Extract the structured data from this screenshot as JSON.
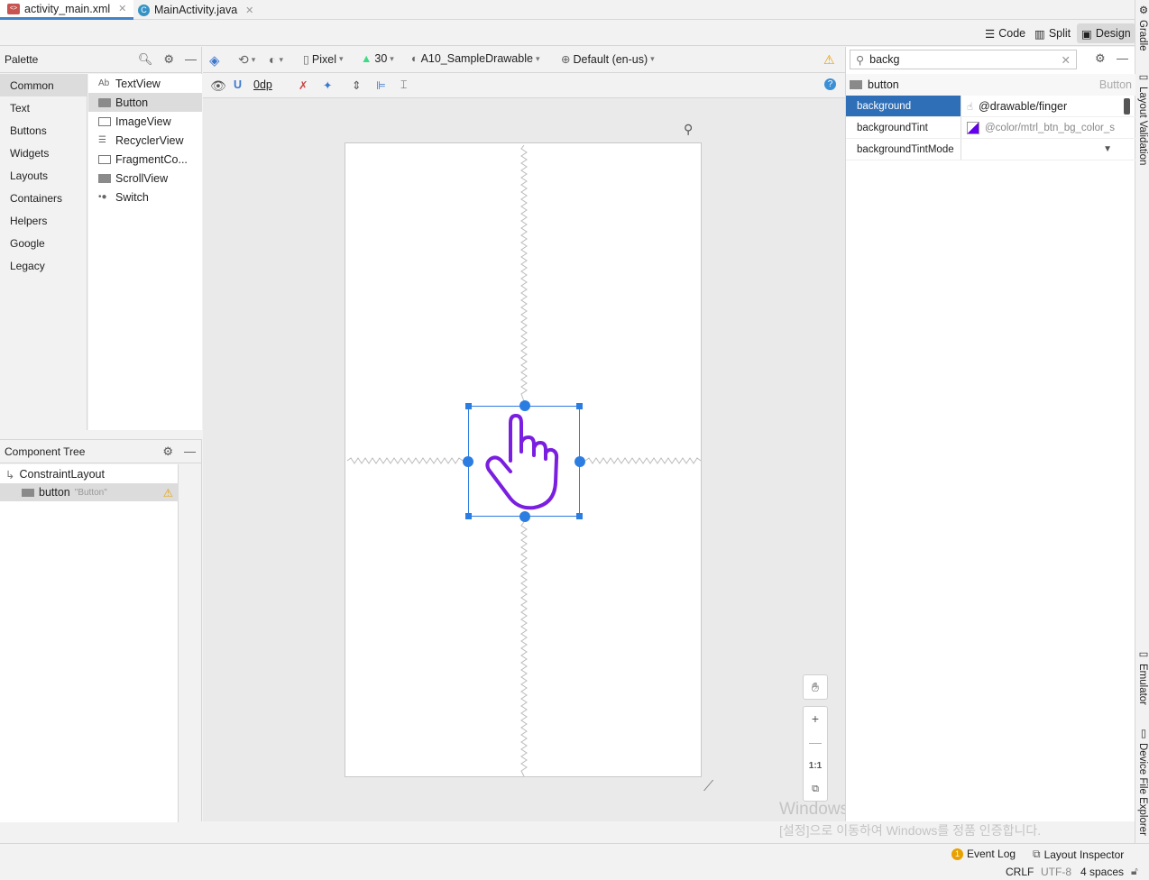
{
  "tabs": [
    {
      "label": "activity_main.xml",
      "icon": "xml-file-icon"
    },
    {
      "label": "MainActivity.java",
      "icon": "java-class-icon",
      "icon_letter": "C"
    }
  ],
  "view_modes": {
    "code": "Code",
    "split": "Split",
    "design": "Design"
  },
  "right_tools": {
    "gradle": "Gradle",
    "layout_validation": "Layout Validation",
    "emulator": "Emulator",
    "device_file_explorer": "Device File Explorer"
  },
  "palette": {
    "title": "Palette",
    "categories": [
      "Common",
      "Text",
      "Buttons",
      "Widgets",
      "Layouts",
      "Containers",
      "Helpers",
      "Google",
      "Legacy"
    ],
    "items": [
      {
        "label": "TextView",
        "icon": "Ab"
      },
      {
        "label": "Button",
        "icon": ""
      },
      {
        "label": "ImageView",
        "icon": ""
      },
      {
        "label": "RecyclerView",
        "icon": ""
      },
      {
        "label": "FragmentCo...",
        "icon": ""
      },
      {
        "label": "ScrollView",
        "icon": ""
      },
      {
        "label": "Switch",
        "icon": ""
      }
    ]
  },
  "component_tree": {
    "title": "Component Tree",
    "root": "ConstraintLayout",
    "child": {
      "name": "button",
      "text": "\"Button\""
    }
  },
  "toolbar": {
    "device": "Pixel",
    "api": "30",
    "theme": "A10_SampleDrawable",
    "locale": "Default (en-us)",
    "margin": "0dp"
  },
  "zoom": {
    "one_to_one": "1:1"
  },
  "attributes": {
    "search": "backg",
    "component": "button",
    "component_type": "Button",
    "rows": [
      {
        "key": "background",
        "value": "@drawable/finger"
      },
      {
        "key": "backgroundTint",
        "value": "@color/mtrl_btn_bg_color_s"
      },
      {
        "key": "backgroundTintMode",
        "value": ""
      }
    ]
  },
  "status_bar": {
    "event_log": "Event Log",
    "event_count": "1",
    "layout_inspector": "Layout Inspector",
    "line_sep": "CRLF",
    "encoding": "UTF-8",
    "indent": "4 spaces"
  },
  "watermark": {
    "line1": "Windows 정품 인증",
    "line2": "[설정]으로 이동하여 Windows를 정품 인증합니다."
  },
  "colors": {
    "accent": "#2b7de1",
    "finger": "#7a1fe0",
    "selection": "#2f6fb7"
  }
}
